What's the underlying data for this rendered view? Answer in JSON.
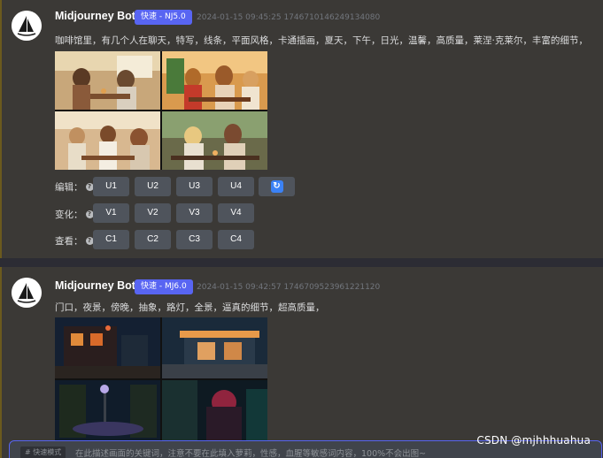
{
  "messages": [
    {
      "bot_name": "Midjourney Bot",
      "badge": "快速 - NJ5.0",
      "timestamp": "2024-01-15 09:45:25 1746710146249134080",
      "prompt": "咖啡馆里，有几个人在聊天，特写，线条，平面风格，卡通插画，夏天，下午，日光，温馨，高质量，莱涅·克莱尔，丰富的细节，",
      "image_alt": "café illustration 2x2 grid",
      "rows": [
        {
          "label": "编辑：",
          "buttons": [
            "U1",
            "U2",
            "U3",
            "U4"
          ],
          "refresh": "refresh-icon"
        },
        {
          "label": "变化：",
          "buttons": [
            "V1",
            "V2",
            "V3",
            "V4"
          ]
        },
        {
          "label": "查看：",
          "buttons": [
            "C1",
            "C2",
            "C3",
            "C4"
          ]
        }
      ]
    },
    {
      "bot_name": "Midjourney Bot",
      "badge": "快速 - MJ6.0",
      "timestamp": "2024-01-15 09:42:57 1746709523961221120",
      "prompt": "门口，夜景，傍晚，抽象，路灯，全景，逼真的细节，超高质量，",
      "image_alt": "night street scene 2x2 grid"
    }
  ],
  "input": {
    "mode_tag": "# 快速模式",
    "placeholder": "在此描述画面的关键词，注意不要在此填入萝莉，性感，血腥等敏感词内容，100%不会出图~"
  },
  "watermark": "CSDN @mjhhhuahua",
  "colors": {
    "accent": "#5865f2",
    "button": "#4f545c",
    "background": "#3b3936"
  }
}
